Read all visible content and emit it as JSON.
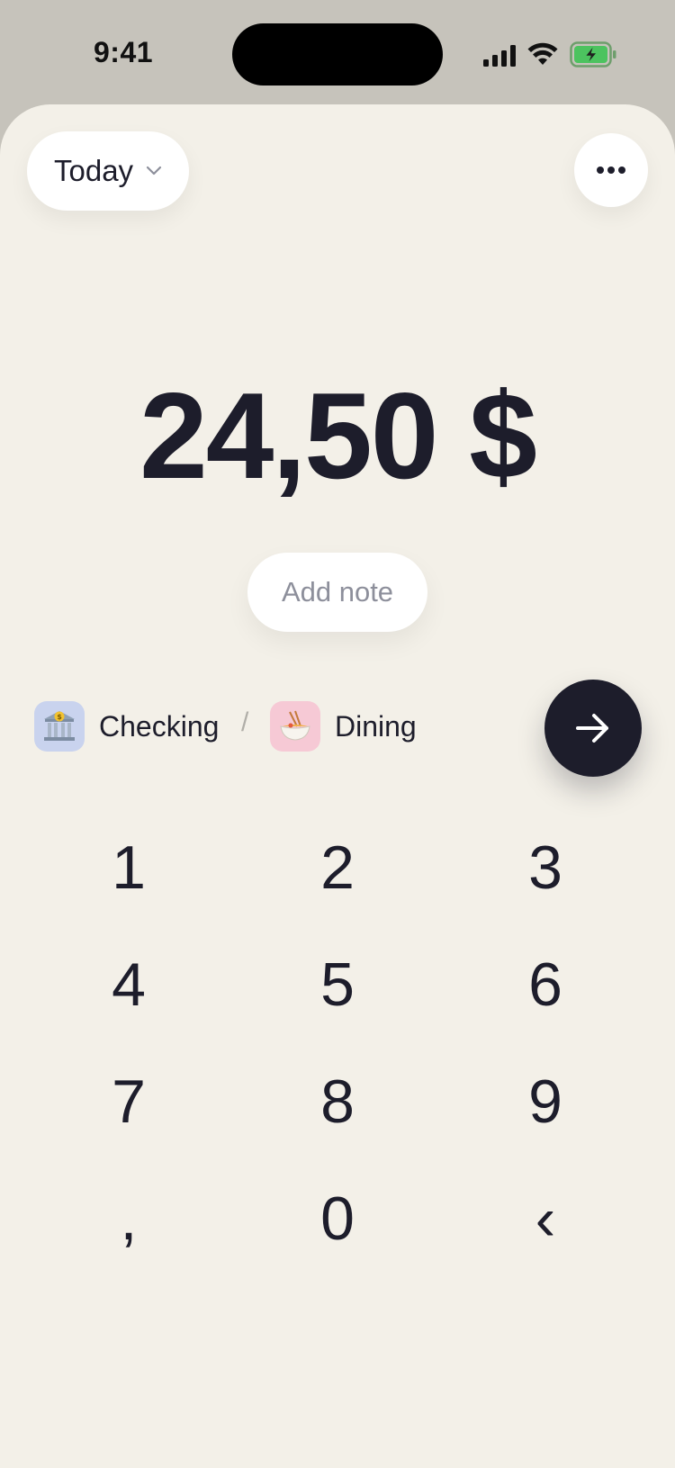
{
  "status_bar": {
    "time": "9:41"
  },
  "header": {
    "date_label": "Today"
  },
  "amount": {
    "value": "24,50",
    "currency": "$"
  },
  "note": {
    "placeholder": "Add note"
  },
  "account": {
    "label": "Checking",
    "icon": "bank-icon"
  },
  "separator": "/",
  "category": {
    "label": "Dining",
    "icon": "noodle-bowl-icon"
  },
  "keypad": {
    "keys": [
      "1",
      "2",
      "3",
      "4",
      "5",
      "6",
      "7",
      "8",
      "9",
      ",",
      "0",
      "‹"
    ]
  },
  "colors": {
    "background": "#f3f0e8",
    "primary": "#1d1d2b",
    "account_bg": "#c9d3ee",
    "category_bg": "#f6c9d5"
  }
}
